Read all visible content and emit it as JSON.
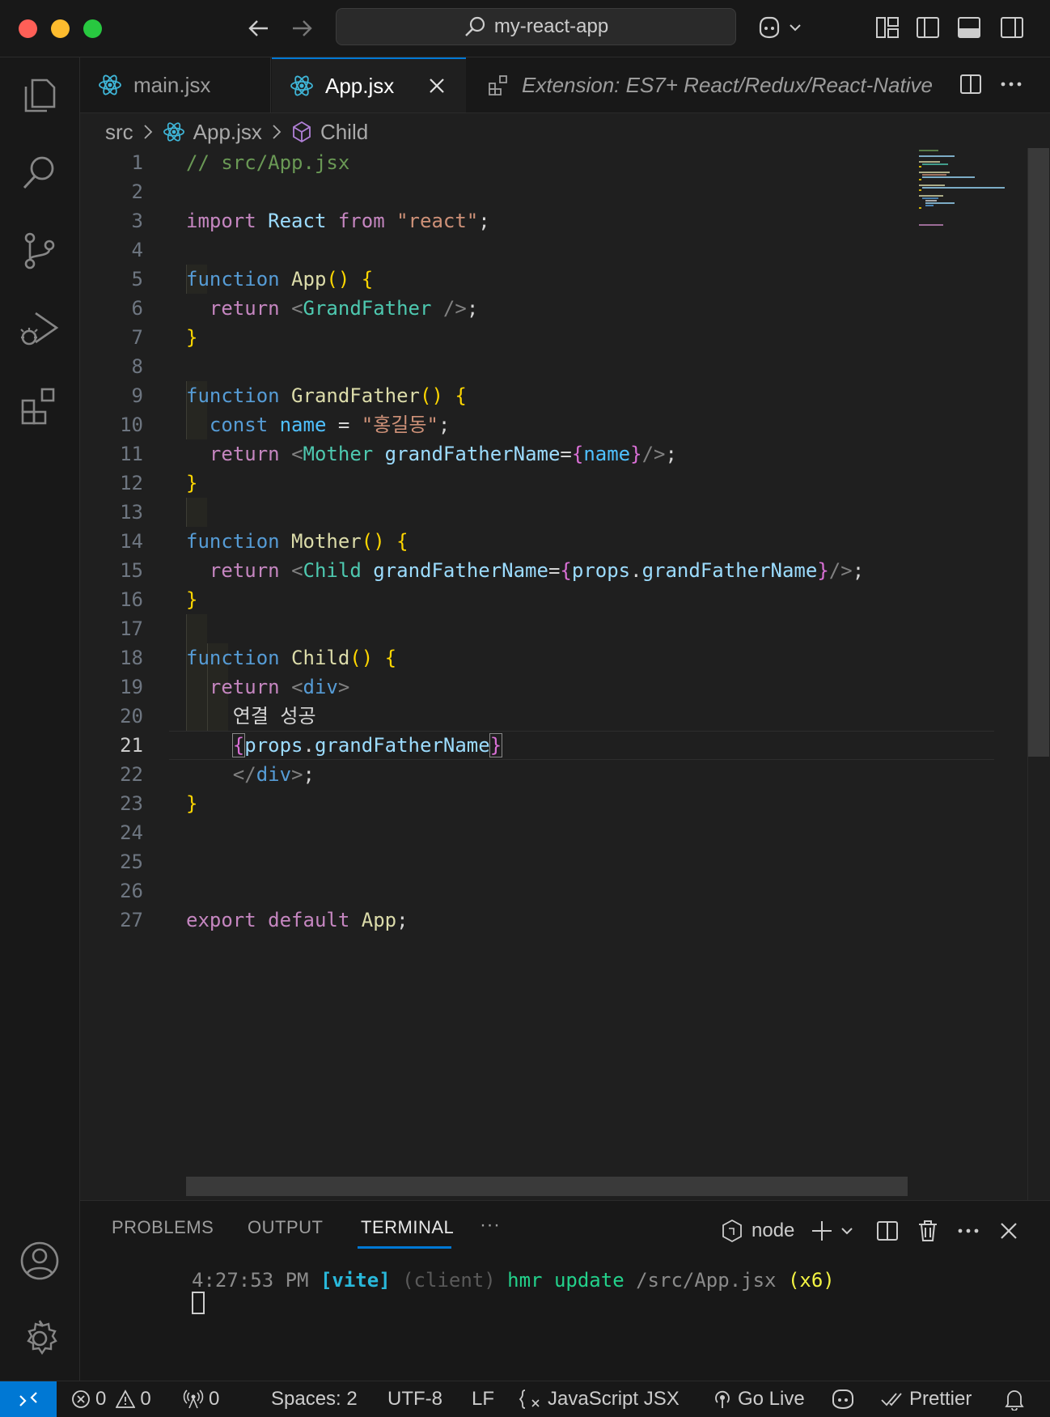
{
  "window": {
    "search_text": "my-react-app"
  },
  "tabs": [
    {
      "label": "main.jsx",
      "active": false
    },
    {
      "label": "App.jsx",
      "active": true
    },
    {
      "label": "Extension: ES7+ React/Redux/React-Native",
      "active": false
    }
  ],
  "breadcrumb": {
    "folder": "src",
    "file": "App.jsx",
    "symbol": "Child"
  },
  "editor": {
    "current_line": 21,
    "lines": [
      {
        "n": "1",
        "text": "// src/App.jsx"
      },
      {
        "n": "2",
        "text": ""
      },
      {
        "n": "3",
        "text": "import React from \"react\";"
      },
      {
        "n": "4",
        "text": ""
      },
      {
        "n": "5",
        "text": "function App() {"
      },
      {
        "n": "6",
        "text": "  return <GrandFather />;"
      },
      {
        "n": "7",
        "text": "}"
      },
      {
        "n": "8",
        "text": ""
      },
      {
        "n": "9",
        "text": "function GrandFather() {"
      },
      {
        "n": "10",
        "text": "  const name = \"홍길동\";"
      },
      {
        "n": "11",
        "text": "  return <Mother grandFatherName={name}/>;"
      },
      {
        "n": "12",
        "text": "}"
      },
      {
        "n": "13",
        "text": ""
      },
      {
        "n": "14",
        "text": "function Mother() {"
      },
      {
        "n": "15",
        "text": "  return <Child grandFatherName={props.grandFatherName}/>;"
      },
      {
        "n": "16",
        "text": "}"
      },
      {
        "n": "17",
        "text": ""
      },
      {
        "n": "18",
        "text": "function Child() {"
      },
      {
        "n": "19",
        "text": "  return <div>"
      },
      {
        "n": "20",
        "text": "    연결 성공"
      },
      {
        "n": "21",
        "text": "    {props.grandFatherName}"
      },
      {
        "n": "22",
        "text": "    </div>;"
      },
      {
        "n": "23",
        "text": "}"
      },
      {
        "n": "24",
        "text": ""
      },
      {
        "n": "25",
        "text": ""
      },
      {
        "n": "26",
        "text": ""
      },
      {
        "n": "27",
        "text": "export default App;"
      }
    ]
  },
  "panel": {
    "tabs": [
      "PROBLEMS",
      "OUTPUT",
      "TERMINAL"
    ],
    "active_tab": "TERMINAL",
    "more": "···",
    "shell": "node",
    "terminal": {
      "time": "4:27:53 PM",
      "tag": "[vite]",
      "client": "(client)",
      "message": "hmr update",
      "path": "/src/App.jsx",
      "count": "(x6)"
    }
  },
  "statusbar": {
    "errors": "0",
    "warnings": "0",
    "ports": "0",
    "spaces": "Spaces: 2",
    "encoding": "UTF-8",
    "eol": "LF",
    "language": "JavaScript JSX",
    "golive": "Go Live",
    "prettier": "Prettier"
  },
  "colors": {
    "accent": "#0078d4",
    "background": "#1f1f1f",
    "chrome": "#181818"
  }
}
